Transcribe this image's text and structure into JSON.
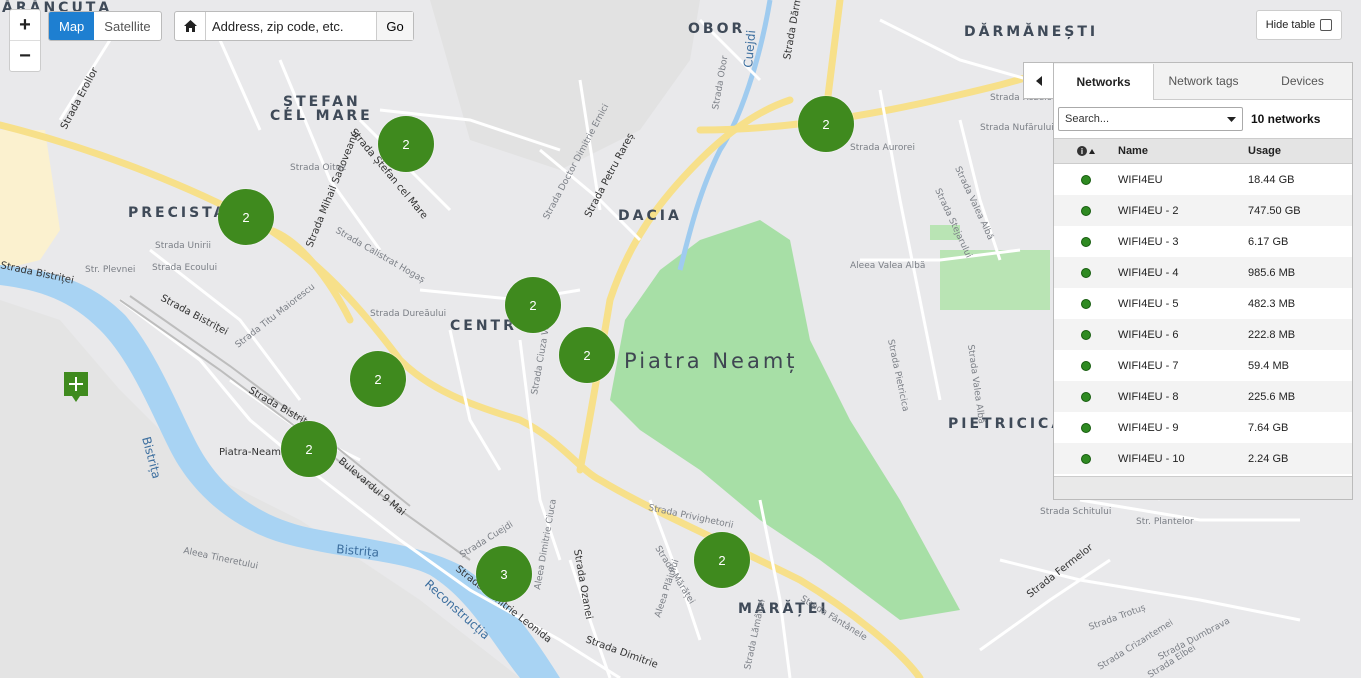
{
  "map": {
    "city": "Piatra Neamț",
    "districts": [
      "ĂRĂNCUȚA",
      "OBOR",
      "DĂRMĂNEȘTI",
      "ȘTEFAN",
      "CEL MARE",
      "PRECISTA",
      "DACIA",
      "CENTRU",
      "PIETRICICA",
      "MĂRĂȚEI"
    ],
    "streets": [
      "Strada Erollor",
      "Strada Ștefan cel Mare",
      "Strada Mihail Sadoveanu",
      "Strada Petru Rareș",
      "Strada Dărmănești",
      "Strada Bistriței",
      "Strada Bistriței",
      "Bulevardul 9 Mai",
      "Strada Dimitrie Leonida",
      "Strada Ozanei",
      "Strada Dimitrie",
      "Strada Fermelor",
      "Piatra-Neamț",
      "Strada Lămâiței",
      "Aleea Valea Albă",
      "Strada Obor",
      "Strada Doctor Dimitrie Ernici",
      "Strada Oituz",
      "Strada Calistrat Hogaș",
      "Strada Dureăului",
      "Strada Titu Maiorescu",
      "Str. Plevnei",
      "Strada Unirii",
      "Strada Ecoului",
      "Strada Privighetorii",
      "Strada Aurorei",
      "Strada Nufărului",
      "Strada Rozelor",
      "Strada Valea Albă",
      "Strada Stejarului",
      "Strada Schitului",
      "Str. Plantelor",
      "Strada Trotuș",
      "Strada Elbei",
      "Strada Crizantemei",
      "Strada Dumbrava",
      "Strada Pietricica",
      "Strada Valea Albă",
      "Strada Ciuza Vodă",
      "Strada Cuejdi",
      "Aleea Plăiului",
      "Aleea Tineretului",
      "Strada Mărăței",
      "Aleea Dimitrie Ciuca",
      "Strada Fântânele"
    ],
    "rivers": [
      "Bistrița",
      "Bistrița",
      "Cuejdi",
      "Reconstrucția"
    ],
    "clusters": [
      {
        "count": "2"
      },
      {
        "count": "2"
      },
      {
        "count": "2"
      },
      {
        "count": "2"
      },
      {
        "count": "2"
      },
      {
        "count": "2"
      },
      {
        "count": "2"
      },
      {
        "count": "3"
      },
      {
        "count": "2"
      }
    ],
    "cluster_color": "#3f8a1e"
  },
  "controls": {
    "zoom_in": "+",
    "zoom_out": "−",
    "map_type": [
      "Map",
      "Satellite"
    ],
    "map_type_active": "Map",
    "address_placeholder": "Address, zip code, etc.",
    "go_label": "Go",
    "hide_table_label": "Hide table",
    "accent": "#1e7fd1"
  },
  "panel": {
    "tabs": [
      "Networks",
      "Network tags",
      "Devices"
    ],
    "active_tab": "Networks",
    "search_placeholder": "Search...",
    "network_count": "10 networks",
    "columns": {
      "status": "",
      "name": "Name",
      "usage": "Usage"
    },
    "rows": [
      {
        "name": "WIFI4EU",
        "usage": "18.44 GB"
      },
      {
        "name": "WIFI4EU - 2",
        "usage": "747.50 GB"
      },
      {
        "name": "WIFI4EU - 3",
        "usage": "6.17 GB"
      },
      {
        "name": "WIFI4EU - 4",
        "usage": "985.6 MB"
      },
      {
        "name": "WIFI4EU - 5",
        "usage": "482.3 MB"
      },
      {
        "name": "WIFI4EU - 6",
        "usage": "222.8 MB"
      },
      {
        "name": "WIFI4EU - 7",
        "usage": "59.4 MB"
      },
      {
        "name": "WIFI4EU - 8",
        "usage": "225.6 MB"
      },
      {
        "name": "WIFI4EU - 9",
        "usage": "7.64 GB"
      },
      {
        "name": "WIFI4EU - 10",
        "usage": "2.24 GB"
      }
    ],
    "status_color": "#2f8a22"
  }
}
